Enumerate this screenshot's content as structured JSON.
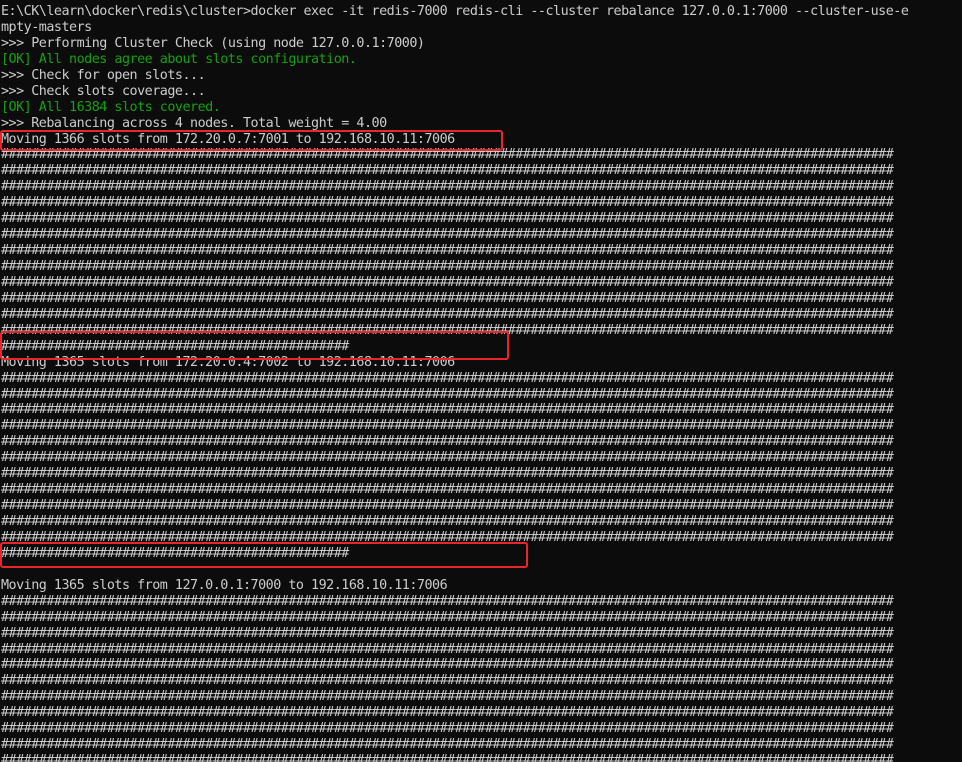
{
  "terminal": {
    "colors": {
      "background": "#0c0c0c",
      "text": "#cccccc",
      "ok": "#13a10e",
      "highlight_box": "#e8262b"
    },
    "lines": [
      {
        "text": "E:\\CK\\learn\\docker\\redis\\cluster>docker exec -it redis-7000 redis-cli --cluster rebalance 127.0.0.1:7000 --cluster-use-e",
        "style": "normal"
      },
      {
        "text": "mpty-masters",
        "style": "normal"
      },
      {
        "text": ">>> Performing Cluster Check (using node 127.0.0.1:7000)",
        "style": "normal"
      },
      {
        "text": "[OK] All nodes agree about slots configuration.",
        "style": "ok"
      },
      {
        "text": ">>> Check for open slots...",
        "style": "normal"
      },
      {
        "text": ">>> Check slots coverage...",
        "style": "normal"
      },
      {
        "text": "[OK] All 16384 slots covered.",
        "style": "ok"
      },
      {
        "text": ">>> Rebalancing across 4 nodes. Total weight = 4.00",
        "style": "normal"
      },
      {
        "text": "Moving 1366 slots from 172.20.0.7:7001 to 192.168.10.11:7006",
        "style": "normal",
        "highlight": true
      },
      {
        "text": "######################################################################################################################",
        "style": "normal"
      },
      {
        "text": "######################################################################################################################",
        "style": "normal"
      },
      {
        "text": "######################################################################################################################",
        "style": "normal"
      },
      {
        "text": "######################################################################################################################",
        "style": "normal"
      },
      {
        "text": "######################################################################################################################",
        "style": "normal"
      },
      {
        "text": "######################################################################################################################",
        "style": "normal"
      },
      {
        "text": "######################################################################################################################",
        "style": "normal"
      },
      {
        "text": "######################################################################################################################",
        "style": "normal"
      },
      {
        "text": "######################################################################################################################",
        "style": "normal"
      },
      {
        "text": "######################################################################################################################",
        "style": "normal"
      },
      {
        "text": "######################################################################################################################",
        "style": "normal"
      },
      {
        "text": "######################################################################################################################",
        "style": "normal"
      },
      {
        "text": "##############################################",
        "style": "normal"
      },
      {
        "text": "Moving 1365 slots from 172.20.0.4:7002 to 192.168.10.11:7006",
        "style": "normal",
        "highlight": true
      },
      {
        "text": "######################################################################################################################",
        "style": "normal"
      },
      {
        "text": "######################################################################################################################",
        "style": "normal"
      },
      {
        "text": "######################################################################################################################",
        "style": "normal"
      },
      {
        "text": "######################################################################################################################",
        "style": "normal"
      },
      {
        "text": "######################################################################################################################",
        "style": "normal"
      },
      {
        "text": "######################################################################################################################",
        "style": "normal"
      },
      {
        "text": "######################################################################################################################",
        "style": "normal"
      },
      {
        "text": "######################################################################################################################",
        "style": "normal"
      },
      {
        "text": "######################################################################################################################",
        "style": "normal"
      },
      {
        "text": "######################################################################################################################",
        "style": "normal"
      },
      {
        "text": "######################################################################################################################",
        "style": "normal"
      },
      {
        "text": "##############################################",
        "style": "normal"
      },
      {
        "text": "",
        "style": "normal"
      },
      {
        "text": "Moving 1365 slots from 127.0.0.1:7000 to 192.168.10.11:7006",
        "style": "normal",
        "highlight": true
      },
      {
        "text": "######################################################################################################################",
        "style": "normal"
      },
      {
        "text": "######################################################################################################################",
        "style": "normal"
      },
      {
        "text": "######################################################################################################################",
        "style": "normal"
      },
      {
        "text": "######################################################################################################################",
        "style": "normal"
      },
      {
        "text": "######################################################################################################################",
        "style": "normal"
      },
      {
        "text": "######################################################################################################################",
        "style": "normal"
      },
      {
        "text": "######################################################################################################################",
        "style": "normal"
      },
      {
        "text": "######################################################################################################################",
        "style": "normal"
      },
      {
        "text": "######################################################################################################################",
        "style": "normal"
      },
      {
        "text": "######################################################################################################################",
        "style": "normal"
      },
      {
        "text": "######################################################################################################################",
        "style": "normal"
      },
      {
        "text": "#############################################",
        "style": "normal"
      }
    ]
  }
}
